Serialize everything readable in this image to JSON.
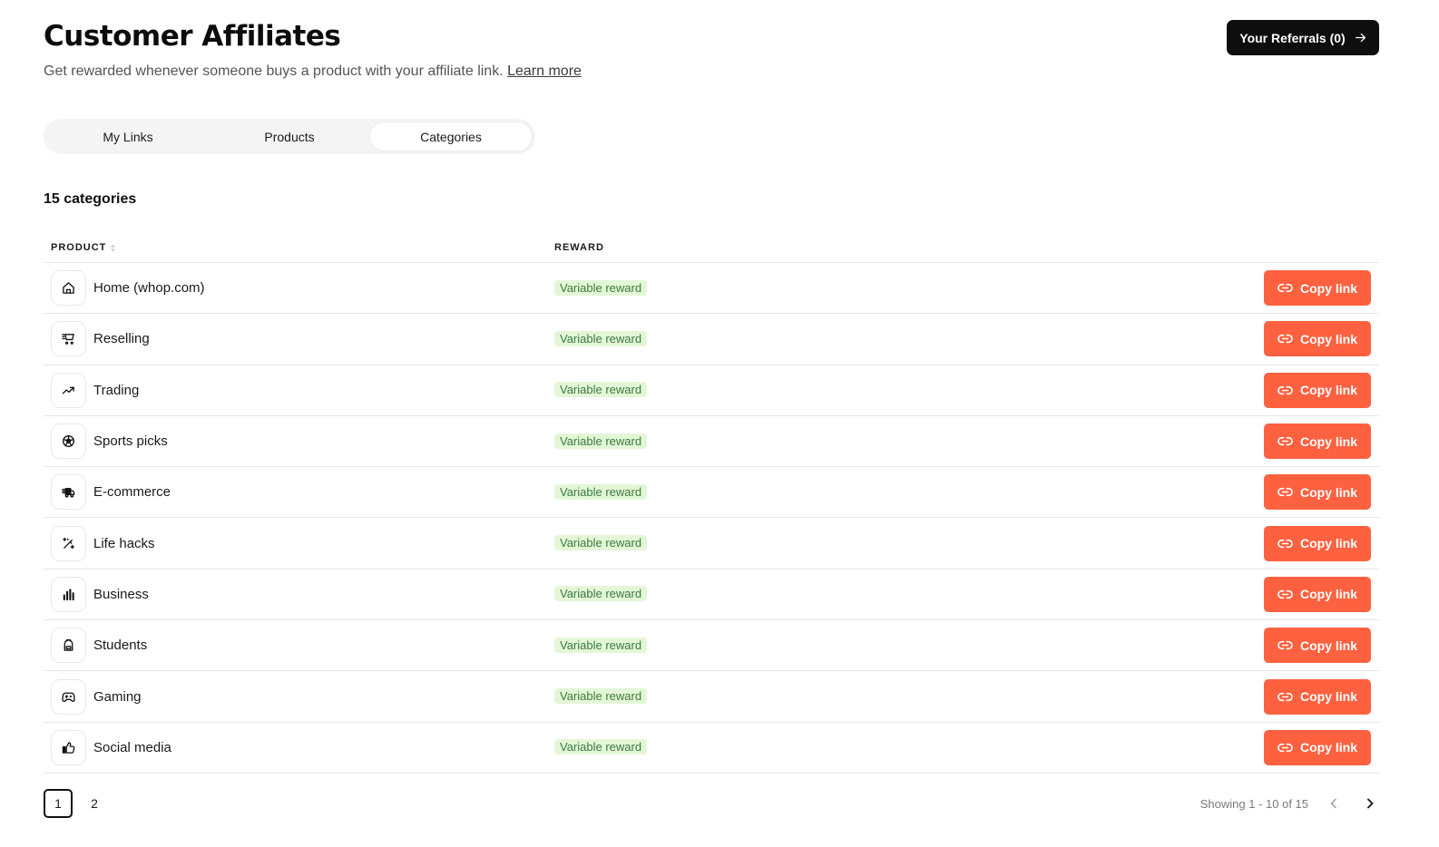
{
  "header": {
    "title": "Customer Affiliates",
    "subtitle": "Get rewarded whenever someone buys a product with your affiliate link.",
    "learn_more": "Learn more",
    "referrals_button": "Your Referrals (0)"
  },
  "tabs": [
    {
      "label": "My Links",
      "active": false
    },
    {
      "label": "Products",
      "active": false
    },
    {
      "label": "Categories",
      "active": true
    }
  ],
  "count_label": "15 categories",
  "table": {
    "columns": {
      "product": "PRODUCT",
      "reward": "REWARD"
    },
    "rows": [
      {
        "name": "Home (whop.com)",
        "icon": "home-icon",
        "reward": "Variable reward",
        "action": "Copy link"
      },
      {
        "name": "Reselling",
        "icon": "shopping-cart-icon",
        "reward": "Variable reward",
        "action": "Copy link"
      },
      {
        "name": "Trading",
        "icon": "trending-up-icon",
        "reward": "Variable reward",
        "action": "Copy link"
      },
      {
        "name": "Sports picks",
        "icon": "soccer-ball-icon",
        "reward": "Variable reward",
        "action": "Copy link"
      },
      {
        "name": "E-commerce",
        "icon": "delivery-truck-icon",
        "reward": "Variable reward",
        "action": "Copy link"
      },
      {
        "name": "Life hacks",
        "icon": "magic-wand-icon",
        "reward": "Variable reward",
        "action": "Copy link"
      },
      {
        "name": "Business",
        "icon": "bar-chart-icon",
        "reward": "Variable reward",
        "action": "Copy link"
      },
      {
        "name": "Students",
        "icon": "backpack-icon",
        "reward": "Variable reward",
        "action": "Copy link"
      },
      {
        "name": "Gaming",
        "icon": "gamepad-icon",
        "reward": "Variable reward",
        "action": "Copy link"
      },
      {
        "name": "Social media",
        "icon": "thumbs-up-icon",
        "reward": "Variable reward",
        "action": "Copy link"
      }
    ]
  },
  "pagination": {
    "pages": [
      "1",
      "2"
    ],
    "current": "1",
    "showing": "Showing 1 - 10 of 15"
  },
  "colors": {
    "accent": "#fe6140",
    "badge_bg": "#e3f7d7",
    "badge_text": "#3b7a3d",
    "dark_button": "#0e0e0e"
  }
}
